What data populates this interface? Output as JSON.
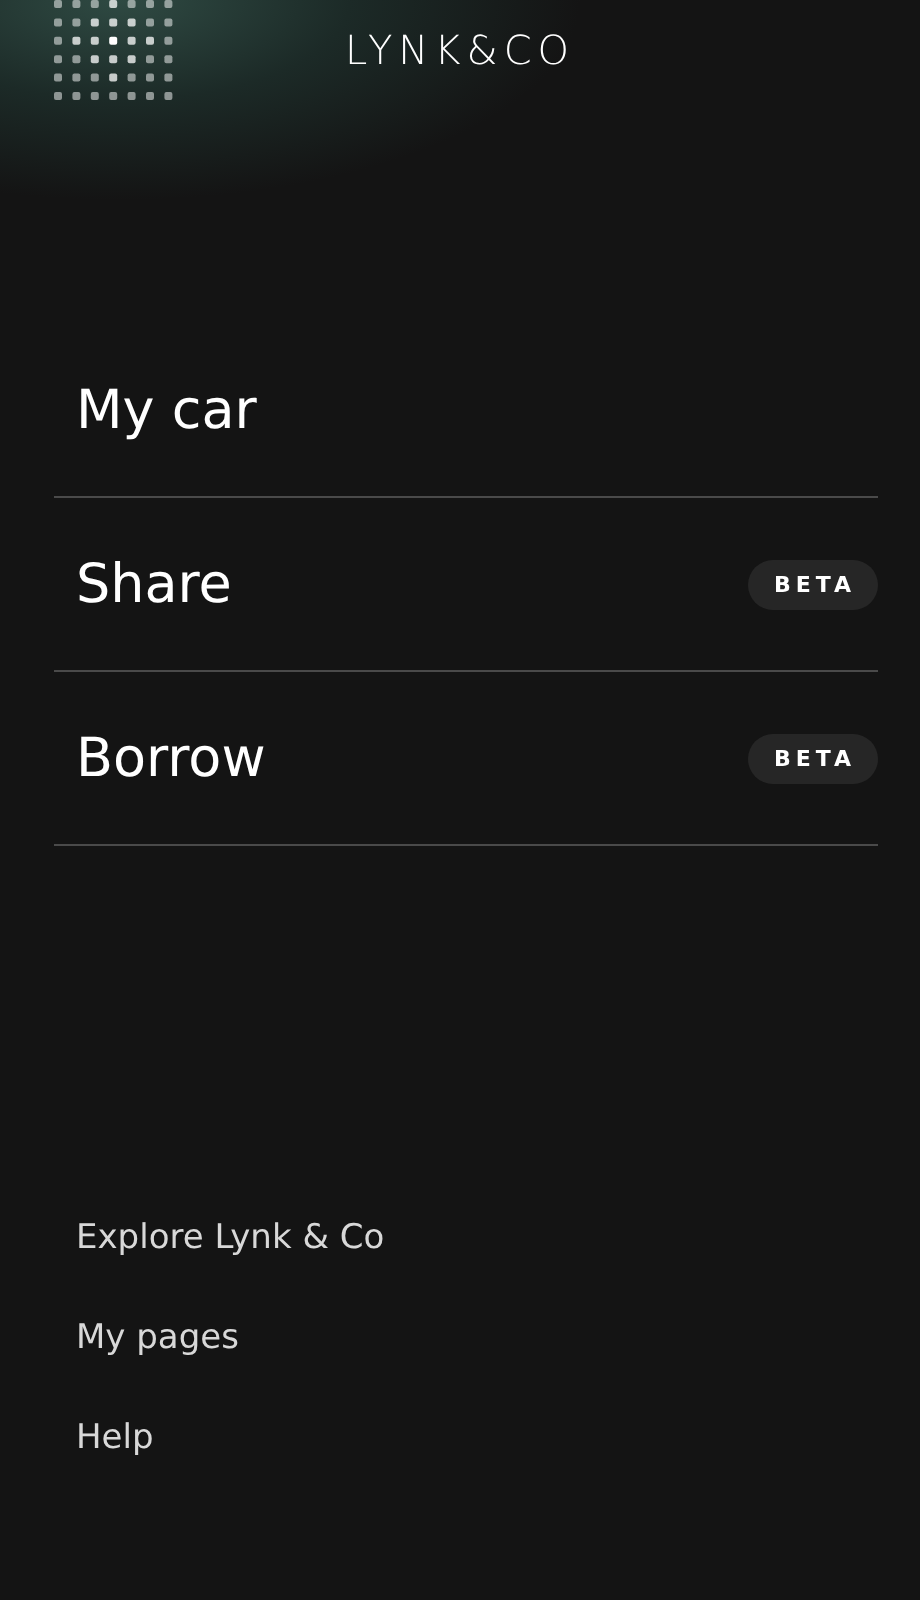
{
  "header": {
    "logo": "LYNK&CO"
  },
  "menu": [
    {
      "label": "My car"
    },
    {
      "label": "Share",
      "badge": "BETA"
    },
    {
      "label": "Borrow",
      "badge": "BETA"
    }
  ],
  "links": [
    {
      "label": "Explore Lynk & Co"
    },
    {
      "label": "My pages"
    },
    {
      "label": "Help"
    }
  ]
}
